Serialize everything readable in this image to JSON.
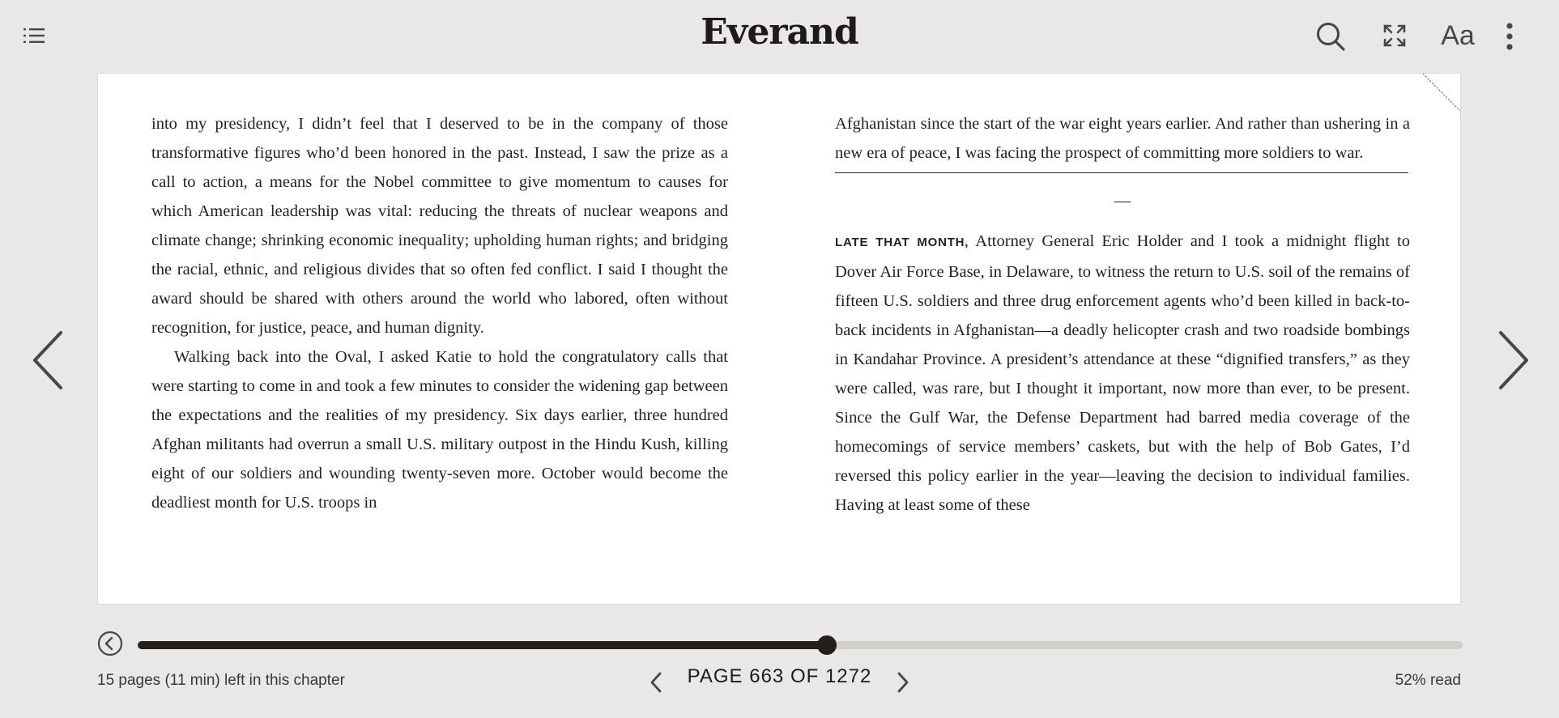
{
  "header": {
    "logo": "Everand",
    "font_button_label": "Aa"
  },
  "icons": {
    "toc": "list-icon",
    "search": "search-icon",
    "fullscreen": "expand-icon",
    "font": "font-settings-icon",
    "more": "more-vertical-icon",
    "prev": "chevron-left-icon",
    "next": "chevron-right-icon",
    "back": "back-circle-icon"
  },
  "book": {
    "left_column": {
      "p1": "into my presidency, I didn’t feel that I deserved to be in the company of those transformative figures who’d been honored in the past. Instead, I saw the prize as a call to action, a means for the Nobel committee to give momentum to causes for which American leadership was vital: reducing the threats of nuclear weapons and climate change; shrinking economic inequality; upholding human rights; and bridging the racial, ethnic, and religious divides that so often fed conflict. I said I thought the award should be shared with others around the world who labored, often without recognition, for justice, peace, and human dignity.",
      "p2": "Walking back into the Oval, I asked Katie to hold the congratulatory calls that were starting to come in and took a few minutes to consider the widening gap between the expectations and the realities of my presidency. Six days earlier, three hundred Afghan militants had overrun a small U.S. military outpost in the Hindu Kush, killing eight of our soldiers and wounding twenty-seven more. October would become the deadliest month for U.S. troops in"
    },
    "right_column": {
      "p1": "Afghanistan since the start of the war eight years earlier. And rather than ushering in a new era of peace, I was facing the prospect of committing more soldiers to war.",
      "section_break": "—",
      "lead_in": "LATE THAT MONTH,",
      "p2": " Attorney General Eric Holder and I took a midnight flight to Dover Air Force Base, in Delaware, to witness the return to U.S. soil of the remains of fifteen U.S. soldiers and three drug enforcement agents who’d been killed in back-to-back incidents in Afghanistan—a deadly helicopter crash and two roadside bombings in Kandahar Province. A president’s attendance at these “dignified transfers,” as they were called, was rare, but I thought it important, now more than ever, to be present. Since the Gulf War, the Defense Department had barred media coverage of the homecomings of service members’ caskets, but with the help of Bob Gates, I’d reversed this policy earlier in the year—leaving the decision to individual families. Having at least some of these"
    }
  },
  "footer": {
    "chapter_remaining": "15 pages (11 min) left in this chapter",
    "page_label": "PAGE 663 OF 1272",
    "percent_read": "52% read",
    "progress_fraction": 0.52
  },
  "colors": {
    "background": "#e9e8e6",
    "page": "#ffffff",
    "accent": "#231f1c",
    "track": "#d2d0cc"
  }
}
